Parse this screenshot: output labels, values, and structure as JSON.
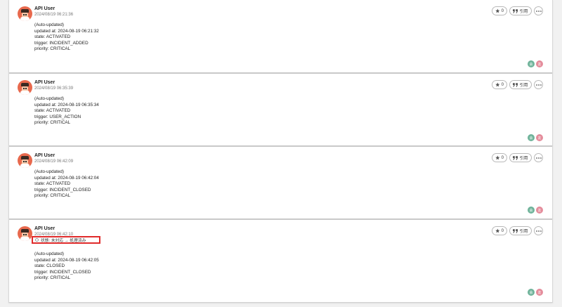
{
  "comments": [
    {
      "user": "API User",
      "date": "2024/08/19 06:21:36",
      "lines": [
        "(Auto-updated)",
        "updated at: 2024-08-19 06:21:32",
        "state: ACTIVATED",
        "trigger: INCIDENT_ADDED",
        "priority: CRITICAL"
      ],
      "star_count": "0",
      "quote_label": "引用"
    },
    {
      "user": "API User",
      "date": "2024/08/19 06:35:39",
      "lines": [
        "(Auto-updated)",
        "updated at: 2024-08-19 06:35:34",
        "state: ACTIVATED",
        "trigger: USER_ACTION",
        "priority: CRITICAL"
      ],
      "star_count": "0",
      "quote_label": "引用"
    },
    {
      "user": "API User",
      "date": "2024/08/19 06:42:09",
      "lines": [
        "(Auto-updated)",
        "updated at: 2024-08-19 06:42:04",
        "state: ACTIVATED",
        "trigger: INCIDENT_CLOSED",
        "priority: CRITICAL"
      ],
      "star_count": "0",
      "quote_label": "引用"
    },
    {
      "user": "API User",
      "date": "2024/08/19 06:42:10",
      "status_change": "状態: 未対応 → 処理済み",
      "lines": [
        "(Auto-updated)",
        "updated at: 2024-08-19 06:42:05",
        "state: CLOSED",
        "trigger: INCIDENT_CLOSED",
        "priority: CRITICAL"
      ],
      "star_count": "0",
      "quote_label": "引用"
    }
  ],
  "reactions": {
    "first": "会",
    "second": "友"
  },
  "colors": {
    "highlight_border": "#e02b2b",
    "avatar": "#e8694d",
    "reaction_green": "#6fb39a",
    "reaction_pink": "#e48b9a"
  },
  "icons": {
    "star": "star-icon",
    "quote": "quote-icon",
    "more": "more-dots-icon"
  }
}
